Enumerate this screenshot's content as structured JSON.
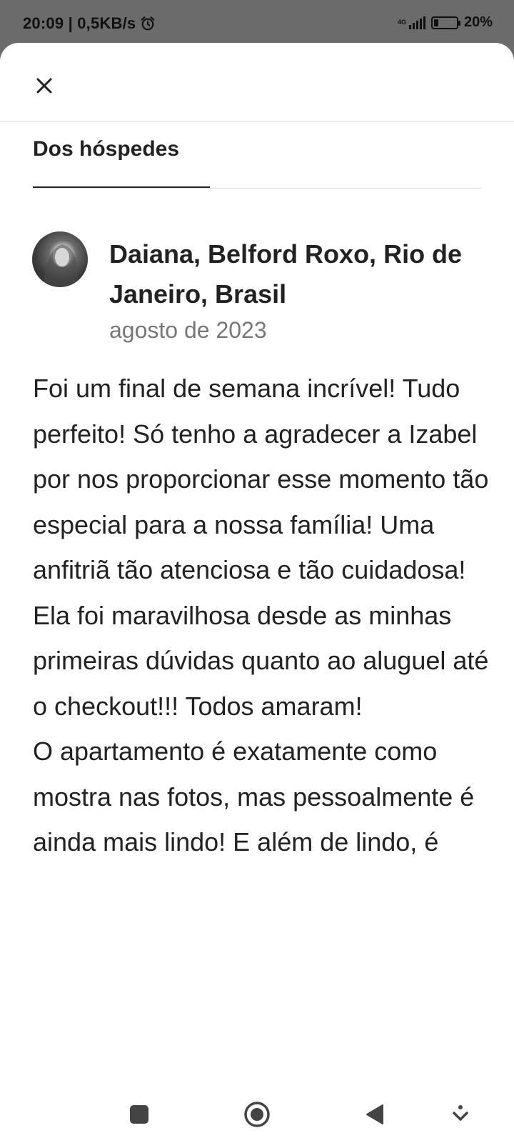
{
  "status": {
    "time_speed": "20:09 | 0,5KB/s",
    "network": "4G",
    "battery": "20%",
    "battery_level": 0.2
  },
  "sheet": {
    "tab_label": "Dos hóspedes"
  },
  "review": {
    "name": "Daiana, Belford Roxo, Rio de Janeiro, Brasil",
    "date": "agosto de 2023",
    "text": "Foi um final de semana incrível! Tudo perfeito! Só tenho a agradecer a Izabel por nos proporcionar esse momento tão especial para a nossa família! Uma anfitriã tão atenciosa e tão cuidadosa! Ela foi maravilhosa desde as minhas primeiras dúvidas quanto ao aluguel até o checkout!!! Todos amaram!\nO apartamento é exatamente como mostra nas fotos, mas pessoalmente é ainda mais lindo! E além de lindo, é"
  },
  "icons": {
    "close": "close-icon",
    "alarm": "alarm-icon",
    "avatar": "avatar"
  }
}
